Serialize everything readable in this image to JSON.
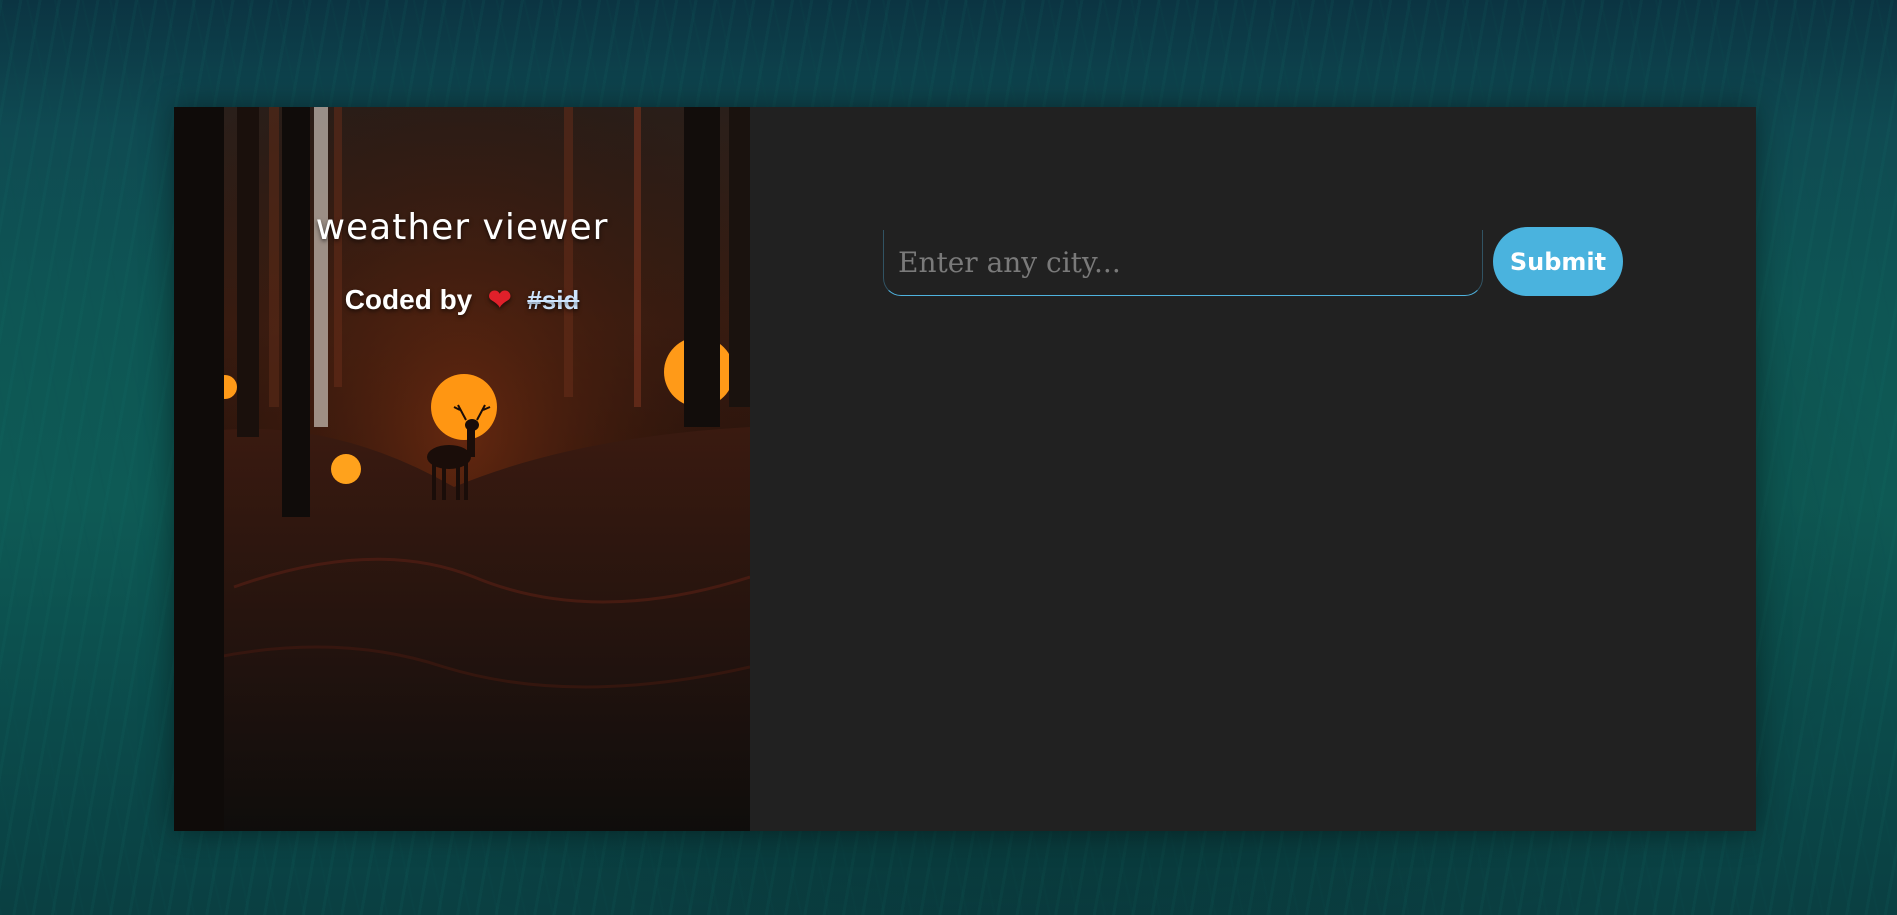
{
  "hero": {
    "title": "weather viewer",
    "credit_prefix": "Coded by",
    "credit_heart": "❤",
    "credit_handle": "#sid"
  },
  "search": {
    "placeholder": "Enter any city...",
    "value": "",
    "submit_label": "Submit"
  },
  "colors": {
    "accent": "#4ab3de",
    "panel": "#212121",
    "heart": "#e0202a"
  }
}
